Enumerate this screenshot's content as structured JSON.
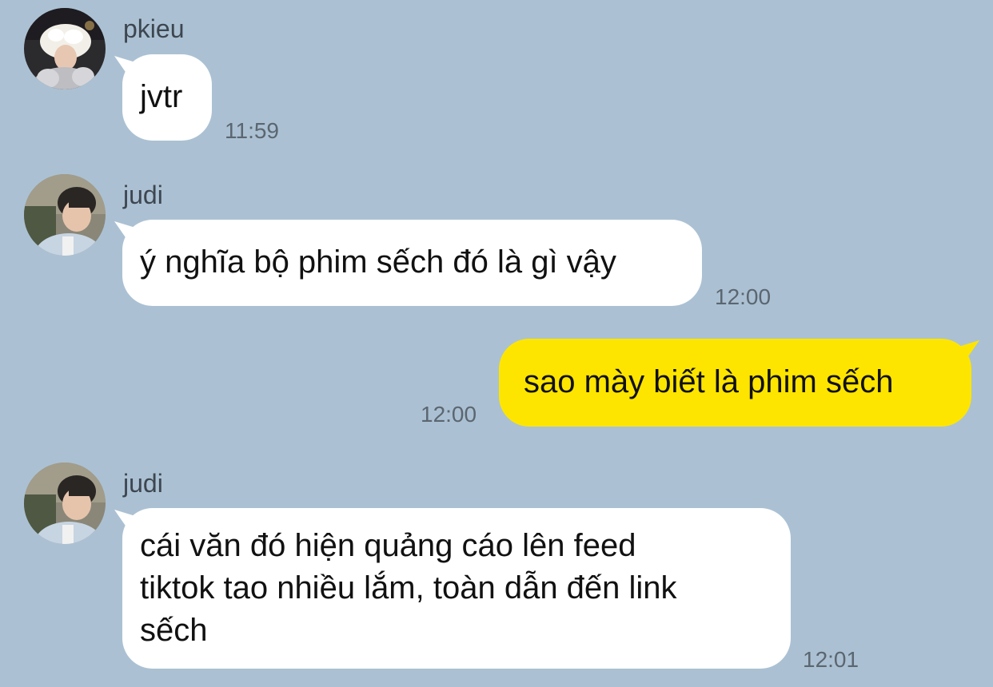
{
  "messages": [
    {
      "sender": "pkieu",
      "text": "jvtr",
      "time": "11:59",
      "avatar": "avatar-pkieu"
    },
    {
      "sender": "judi",
      "text": "ý nghĩa bộ phim sếch đó là gì vậy",
      "time": "12:00",
      "avatar": "avatar-judi"
    },
    {
      "sender": "me",
      "text": "sao mày biết là phim sếch",
      "time": "12:00"
    },
    {
      "sender": "judi",
      "lines": [
        "cái văn đó hiện quảng cáo lên feed",
        "tiktok tao nhiều lắm, toàn dẫn đến link",
        "sếch"
      ],
      "time": "12:01",
      "avatar": "avatar-judi"
    }
  ],
  "colors": {
    "background": "#abc1d3",
    "incoming_bubble": "#ffffff",
    "outgoing_bubble": "#fee500",
    "timestamp": "#5b6670"
  }
}
